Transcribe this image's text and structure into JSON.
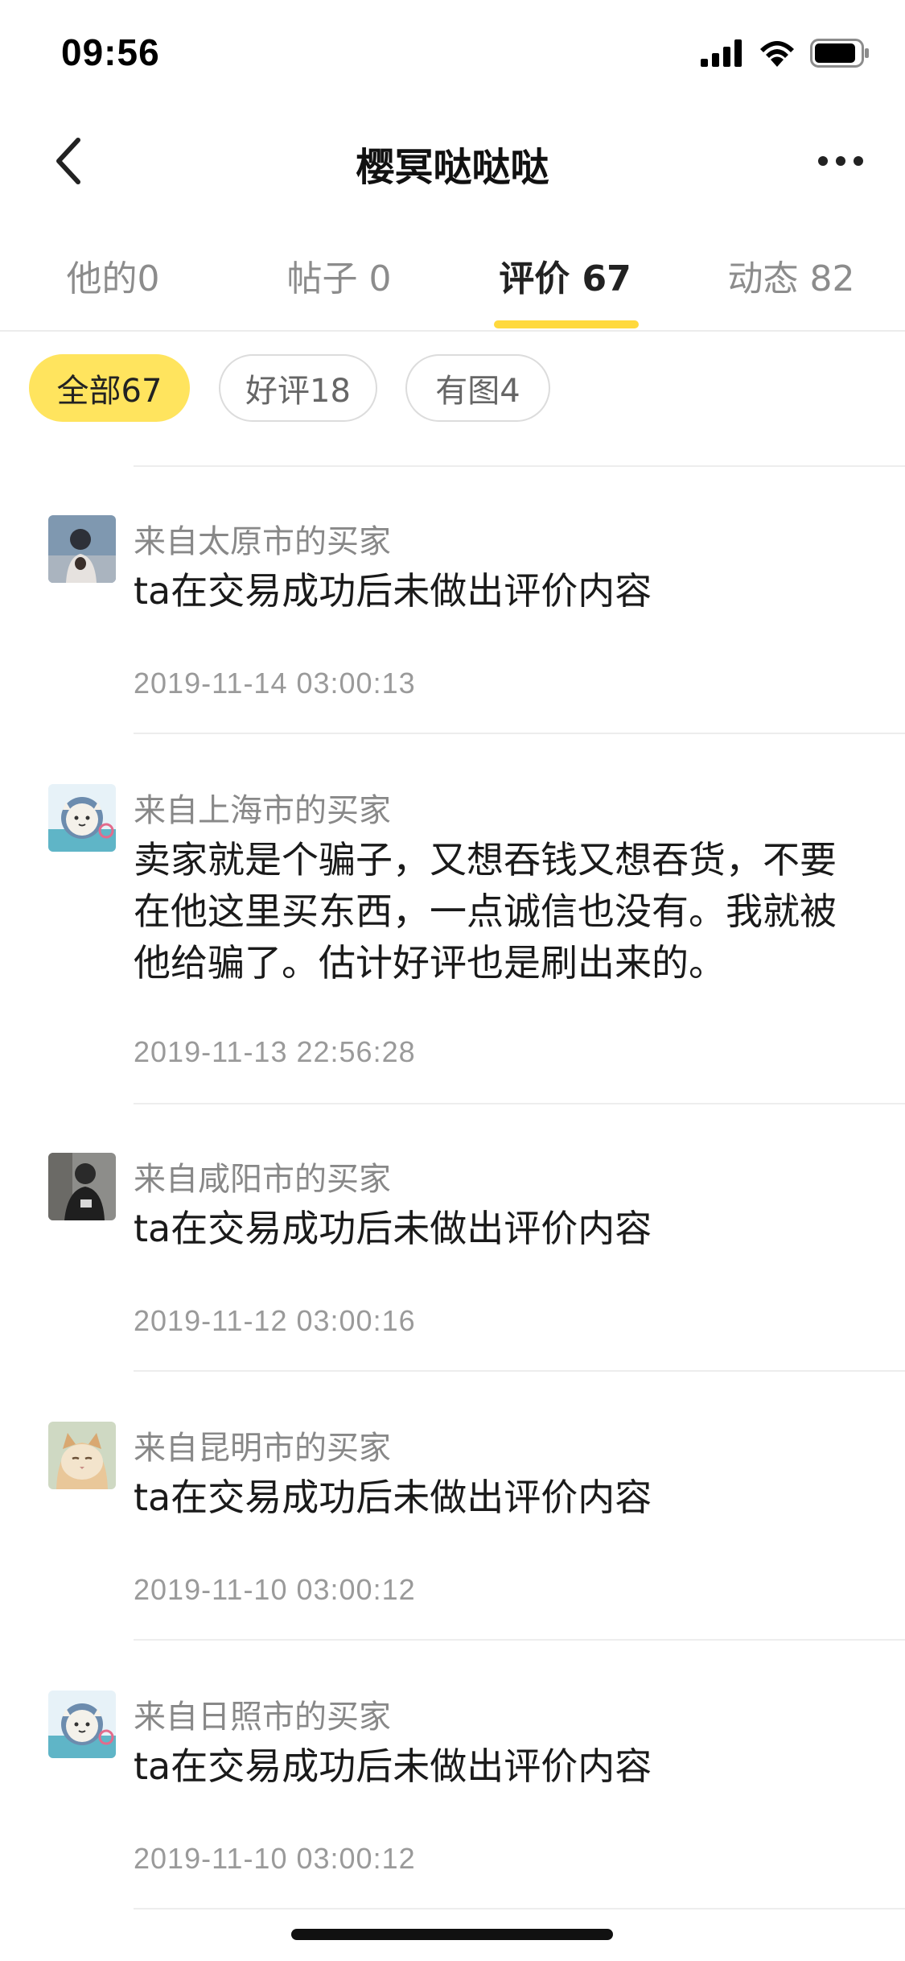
{
  "status_bar": {
    "time": "09:56"
  },
  "header": {
    "title": "樱冥哒哒哒"
  },
  "tabs": [
    {
      "label": "他的0",
      "active": false
    },
    {
      "label": "帖子 0",
      "active": false
    },
    {
      "label": "评价 67",
      "active": true
    },
    {
      "label": "动态 82",
      "active": false
    }
  ],
  "filters": [
    {
      "label": "全部67",
      "active": true
    },
    {
      "label": "好评18",
      "active": false
    },
    {
      "label": "有图4",
      "active": false
    }
  ],
  "reviews": [
    {
      "from": "来自太原市的买家",
      "text": "ta在交易成功后未做出评价内容",
      "date": "2019-11-14 03:00:13",
      "avatar": "photo-avatar-icon"
    },
    {
      "from": "来自上海市的买家",
      "text": "卖家就是个骗子，又想吞钱又想吞货，不要在他这里买东西，一点诚信也没有。我就被他给骗了。估计好评也是刷出来的。",
      "date": "2019-11-13 22:56:28",
      "avatar": "cartoon-cat-avatar-icon"
    },
    {
      "from": "来自咸阳市的买家",
      "text": "ta在交易成功后未做出评价内容",
      "date": "2019-11-12 03:00:16",
      "avatar": "photo-avatar-icon"
    },
    {
      "from": "来自昆明市的买家",
      "text": "ta在交易成功后未做出评价内容",
      "date": "2019-11-10 03:00:12",
      "avatar": "cat-photo-avatar-icon"
    },
    {
      "from": "来自日照市的买家",
      "text": "ta在交易成功后未做出评价内容",
      "date": "2019-11-10 03:00:12",
      "avatar": "cartoon-cat-avatar-icon"
    }
  ],
  "colors": {
    "accent": "#ffd93d",
    "chip_active": "#ffe45e"
  }
}
